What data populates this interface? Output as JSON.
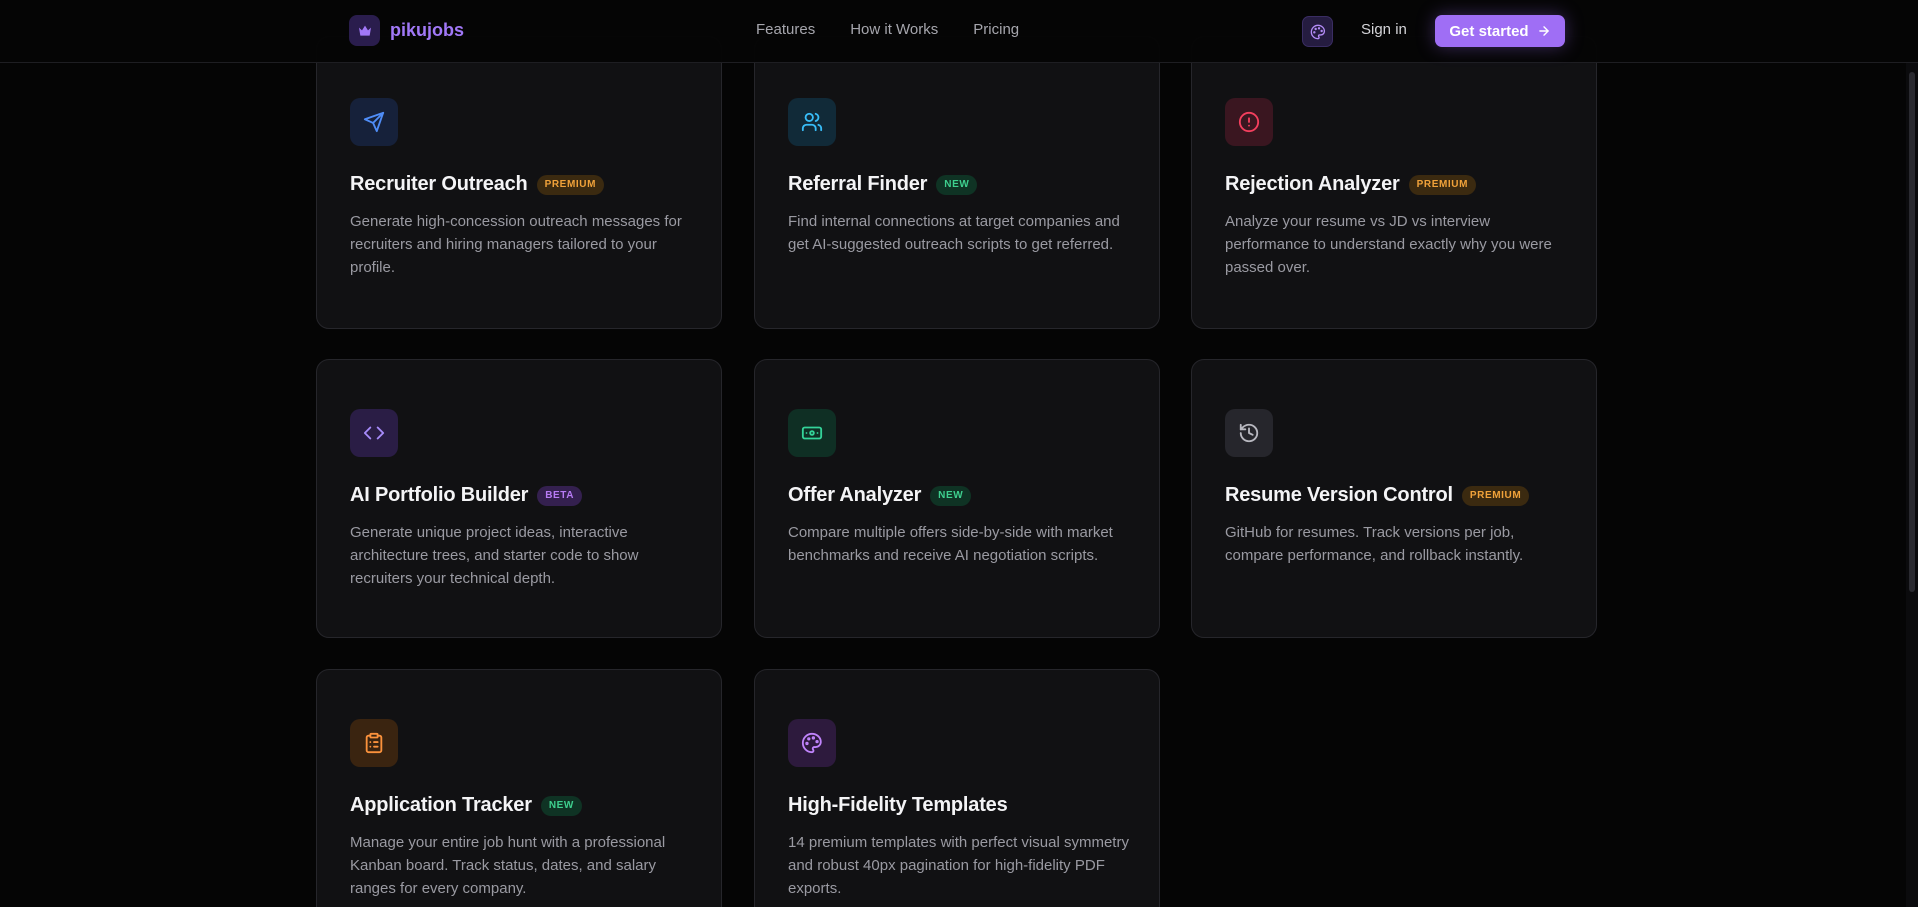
{
  "header": {
    "brand": "pikujobs",
    "nav": [
      "Features",
      "How it Works",
      "Pricing"
    ],
    "sign_in": "Sign in",
    "cta": "Get started"
  },
  "colors": {
    "accent": "#9f6ef5",
    "premium": "#f0a23a",
    "new": "#3ecf8e",
    "beta": "#b77bf5"
  },
  "cards": [
    {
      "title": "Recruiter Outreach",
      "badge": "PREMIUM",
      "icon": "send-icon",
      "desc": "Generate high-concession outreach messages for recruiters and hiring managers tailored to your profile."
    },
    {
      "title": "Referral Finder",
      "badge": "NEW",
      "icon": "users-icon",
      "desc": "Find internal connections at target companies and get AI-suggested outreach scripts to get referred."
    },
    {
      "title": "Rejection Analyzer",
      "badge": "PREMIUM",
      "icon": "alert-circle-icon",
      "desc": "Analyze your resume vs JD vs interview performance to understand exactly why you were passed over."
    },
    {
      "title": "AI Portfolio Builder",
      "badge": "BETA",
      "icon": "code-icon",
      "desc": "Generate unique project ideas, interactive architecture trees, and starter code to show recruiters your technical depth."
    },
    {
      "title": "Offer Analyzer",
      "badge": "NEW",
      "icon": "banknote-icon",
      "desc": "Compare multiple offers side-by-side with market benchmarks and receive AI negotiation scripts."
    },
    {
      "title": "Resume Version Control",
      "badge": "PREMIUM",
      "icon": "history-icon",
      "desc": "GitHub for resumes. Track versions per job, compare performance, and rollback instantly."
    },
    {
      "title": "Application Tracker",
      "badge": "NEW",
      "icon": "clipboard-list-icon",
      "desc": "Manage your entire job hunt with a professional Kanban board. Track status, dates, and salary ranges for every company."
    },
    {
      "title": "High-Fidelity Templates",
      "badge": "",
      "icon": "palette-icon",
      "desc": "14 premium templates with perfect visual symmetry and robust 40px pagination for high-fidelity PDF exports."
    }
  ]
}
